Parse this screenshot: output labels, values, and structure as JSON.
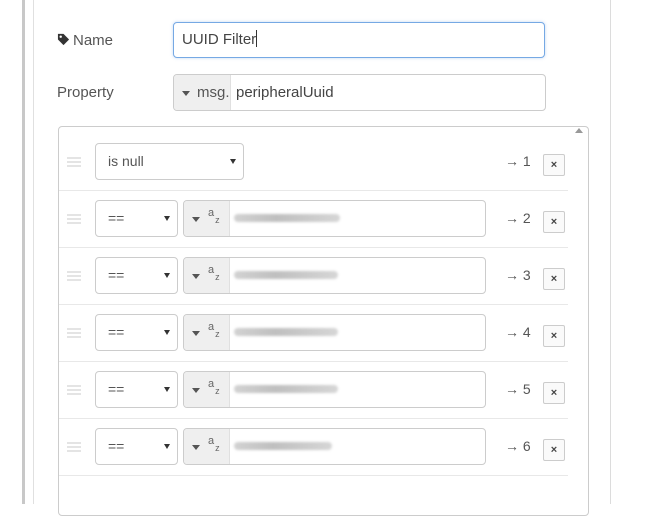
{
  "form": {
    "name_label": "Name",
    "name_value": "UUID Filter",
    "property_label": "Property",
    "property_prefix": "msg.",
    "property_value": "peripheralUuid"
  },
  "rules": [
    {
      "operator": "is null",
      "output": "→ 1",
      "delete_label": "×"
    },
    {
      "operator": "==",
      "value_type": "a z",
      "value": "",
      "output": "→ 2",
      "delete_label": "×"
    },
    {
      "operator": "==",
      "value_type": "a z",
      "value": "",
      "output": "→ 3",
      "delete_label": "×"
    },
    {
      "operator": "==",
      "value_type": "a z",
      "value": "",
      "output": "→ 4",
      "delete_label": "×"
    },
    {
      "operator": "==",
      "value_type": "a z",
      "value": "",
      "output": "→ 5",
      "delete_label": "×"
    },
    {
      "operator": "==",
      "value_type": "a z",
      "value": "",
      "output": "→ 6",
      "delete_label": "×"
    }
  ],
  "colors": {
    "focus_border": "#76a9e4",
    "type_bg": "#efefef"
  }
}
